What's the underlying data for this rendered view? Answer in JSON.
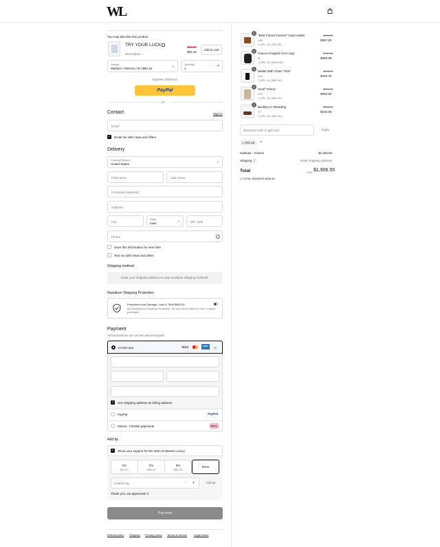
{
  "header": {
    "logo": "WL"
  },
  "upsell": {
    "heading": "You may also like this product",
    "name": "TRY YOUR LUCK",
    "old_price": "$85.00",
    "price": "$60.10",
    "description": "Description",
    "add_label": "Add to cart",
    "variant_label": "Variant",
    "variant_value": "Medium / Women / M | $60.10",
    "quantity_label": "Quantity",
    "quantity_value": "1"
  },
  "express": {
    "label": "Express checkout",
    "paypal": "PayPal",
    "or": "OR"
  },
  "contact": {
    "heading": "Contact",
    "signin": "Sign in",
    "email_placeholder": "Email",
    "news_label": "Email me with news and offers"
  },
  "delivery": {
    "heading": "Delivery",
    "country_label": "Country/Region",
    "country_value": "United States",
    "first_name": "First name",
    "last_name": "Last name",
    "company": "Company (optional)",
    "address": "Address",
    "city": "City",
    "state_label": "State",
    "state_value": "Iowa",
    "zip": "ZIP code",
    "phone": "Phone",
    "save_info": "Save this information for next time",
    "text_me": "Text me with news and offers"
  },
  "shipping_method": {
    "heading": "Shipping method",
    "message": "Enter your shipping address to view available shipping methods."
  },
  "protection": {
    "heading": "Navidium Shipping Protection",
    "title": "Protection from Damage, Loss & Theft $500.00",
    "note": "By Deselecting Shipping Protection, we will not be liable for lost or stolen packages"
  },
  "payment": {
    "heading": "Payment",
    "subtitle": "All transactions are secure and encrypted.",
    "credit_card": "Credit card",
    "visa": "VISA",
    "amex": "AMEX",
    "more": "+3",
    "billing_same": "Use shipping address as billing address",
    "paypal": "PayPal",
    "paypal_logo": "PayPal",
    "klarna": "Klarna - Flexible payments",
    "klarna_logo": "Klarna."
  },
  "tip": {
    "heading": "Add tip",
    "support": "Show your support for the team at Wanan Luxury",
    "options": [
      {
        "pct": "1%",
        "amt": "$19.07"
      },
      {
        "pct": "2%",
        "amt": "$38.13"
      },
      {
        "pct": "5%",
        "amt": "$95.33"
      }
    ],
    "none": "None",
    "custom_placeholder": "Custom tip",
    "add_label": "Add tip",
    "thanks": "Thank you, we appreciate it."
  },
  "pay_now": "Pay now",
  "footer_links": [
    "Refund policy",
    "Shipping",
    "Privacy policy",
    "Terms of service",
    "Legal notice"
  ],
  "summary": {
    "items": [
      {
        "qty": "1",
        "name": "\"Best Friend Forever\" Card Holder",
        "variant": "UNI",
        "discount": "APL-15 (-$76.25)",
        "old": "$463.50",
        "price": "$387.60"
      },
      {
        "qty": "1",
        "name": "Giacca Cropped Con Logo",
        "variant": "M",
        "discount": "APL-15 (-$118.33)",
        "old": "$787.50",
        "price": "$669.95"
      },
      {
        "qty": "1",
        "name": "Wallet With Chain \"Kira\"",
        "variant": "UNI",
        "discount": "APL-15 (-$60.90)",
        "old": "$406.00",
        "price": "$345.10"
      },
      {
        "qty": "1",
        "name": "Scarf \"Ginny\"",
        "variant": "UNI",
        "discount": "APL-15 (-$53.10)",
        "old": "$354.00",
        "price": "$300.90"
      },
      {
        "qty": "1",
        "name": "Buckley In Shearling",
        "variant": "37",
        "discount": "APL-15 (-$34.20)",
        "old": "$228.00",
        "price": "$193.80"
      }
    ],
    "discount_placeholder": "Discount code or gift card",
    "apply": "Apply",
    "applied_code": "APL-15",
    "subtotal_label": "Subtotal · 5 items",
    "subtotal_value": "$1,906.55",
    "shipping_label": "Shipping",
    "shipping_value": "Enter shipping address",
    "total_label": "Total",
    "currency": "USD",
    "total_value": "$1,906.55",
    "savings_label": "TOTAL SAVINGS",
    "savings_value": "$336.45"
  },
  "colors": {
    "paypal_yellow": "#ffc439",
    "pay_button": "#8a8a8a",
    "amex": "#2e77bb",
    "klarna": "#ffb3c7"
  }
}
